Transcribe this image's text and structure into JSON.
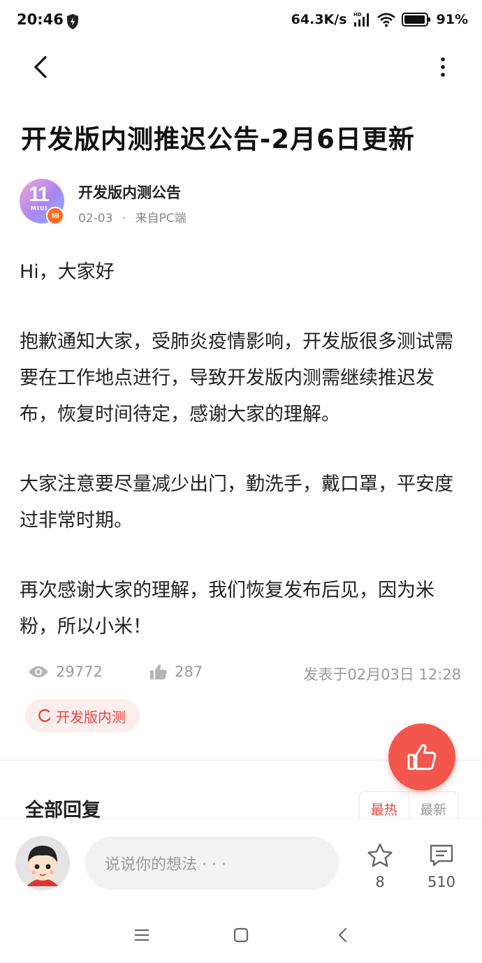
{
  "status_bar": {
    "time": "20:46",
    "network_speed": "64.3K/s",
    "hd_label": "HD",
    "battery": "91%",
    "icons": [
      "shield-icon",
      "signal-icon",
      "wifi-icon",
      "battery-icon"
    ]
  },
  "header": {
    "back_icon": "back-arrow-icon",
    "more_icon": "more-vertical-icon"
  },
  "post": {
    "title": "开发版内测推迟公告-2月6日更新",
    "author": {
      "name": "开发版内测公告",
      "avatar_text": "11",
      "avatar_sub": "MIUI",
      "badge": "MI",
      "date": "02-03",
      "separator": "·",
      "source": "来自PC端"
    },
    "paragraphs": [
      "Hi，大家好",
      "抱歉通知大家，受肺炎疫情影响，开发版很多测试需要在工作地点进行，导致开发版内测需继续推迟发布，恢复时间待定，感谢大家的理解。",
      "大家注意要尽量减少出门，勤洗手，戴口罩，平安度过非常时期。",
      "再次感谢大家的理解，我们恢复发布后见，因为米粉，所以小米！"
    ],
    "stats": {
      "views": "29772",
      "likes": "287",
      "posted": "发表于02月03日 12:28"
    },
    "tag": "开发版内测"
  },
  "replies": {
    "title": "全部回复",
    "sort_hot": "最热",
    "sort_new": "最新"
  },
  "bottom_bar": {
    "comment_placeholder": "说说你的想法 · · ·",
    "favorites": "8",
    "comments": "510"
  },
  "colors": {
    "accent": "#f2564c",
    "tag_bg": "#fdeeee",
    "tag_text": "#e8463c"
  }
}
